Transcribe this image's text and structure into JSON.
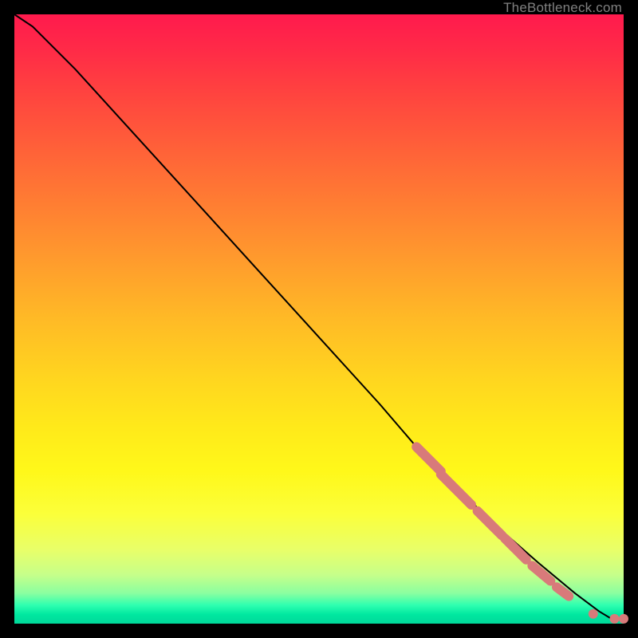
{
  "watermark": "TheBottleneck.com",
  "chart_data": {
    "type": "line",
    "title": "",
    "xlabel": "",
    "ylabel": "",
    "xlim": [
      0,
      100
    ],
    "ylim": [
      0,
      100
    ],
    "series": [
      {
        "name": "curve",
        "x": [
          0,
          3,
          6,
          10,
          15,
          20,
          30,
          40,
          50,
          60,
          66,
          70,
          74,
          78,
          82,
          86,
          92,
          96,
          98,
          100
        ],
        "y": [
          100,
          98,
          95,
          91,
          85.5,
          80,
          69,
          58,
          47,
          36,
          29,
          25,
          21,
          17,
          13.5,
          10,
          5,
          2,
          0.8,
          0.8
        ]
      }
    ],
    "markers": {
      "name": "highlighted-points",
      "color": "#d87a7a",
      "segments": [
        {
          "x0": 66,
          "y0": 29,
          "x1": 70,
          "y1": 25
        },
        {
          "x0": 70,
          "y0": 24.5,
          "x1": 75,
          "y1": 19.5
        },
        {
          "x0": 76,
          "y0": 18.5,
          "x1": 80,
          "y1": 14.5
        },
        {
          "x0": 80.5,
          "y0": 14,
          "x1": 84,
          "y1": 10.5
        },
        {
          "x0": 85,
          "y0": 9.5,
          "x1": 88,
          "y1": 7
        },
        {
          "x0": 89,
          "y0": 6,
          "x1": 91,
          "y1": 4.5
        }
      ],
      "points": [
        {
          "x": 95,
          "y": 1.6
        },
        {
          "x": 98.5,
          "y": 0.8
        },
        {
          "x": 100,
          "y": 0.8
        }
      ]
    }
  }
}
